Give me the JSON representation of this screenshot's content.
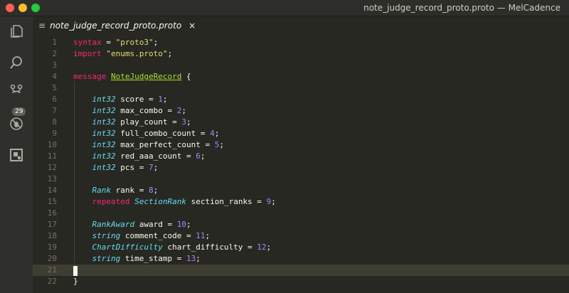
{
  "window": {
    "title": "note_judge_record_proto.proto — MelCadence"
  },
  "activity_bar": {
    "scm_badge": "29"
  },
  "tab": {
    "label": "note_judge_record_proto.proto",
    "close": "×"
  },
  "lines": [
    {
      "n": "1",
      "tokens": [
        {
          "t": "syntax",
          "c": "kw"
        },
        {
          "t": " = "
        },
        {
          "t": "\"proto3\"",
          "c": "str"
        },
        {
          "t": ";"
        }
      ]
    },
    {
      "n": "2",
      "tokens": [
        {
          "t": "import",
          "c": "kw"
        },
        {
          "t": " "
        },
        {
          "t": "\"enums.proto\"",
          "c": "str"
        },
        {
          "t": ";"
        }
      ]
    },
    {
      "n": "3",
      "tokens": []
    },
    {
      "n": "4",
      "tokens": [
        {
          "t": "message",
          "c": "kw"
        },
        {
          "t": " "
        },
        {
          "t": "NoteJudgeRecord",
          "c": "cls"
        },
        {
          "t": " {"
        }
      ]
    },
    {
      "n": "5",
      "tokens": []
    },
    {
      "n": "6",
      "tokens": [
        {
          "t": "    "
        },
        {
          "t": "int32",
          "c": "typ"
        },
        {
          "t": " score = "
        },
        {
          "t": "1",
          "c": "num"
        },
        {
          "t": ";"
        }
      ]
    },
    {
      "n": "7",
      "tokens": [
        {
          "t": "    "
        },
        {
          "t": "int32",
          "c": "typ"
        },
        {
          "t": " max_combo = "
        },
        {
          "t": "2",
          "c": "num"
        },
        {
          "t": ";"
        }
      ]
    },
    {
      "n": "8",
      "tokens": [
        {
          "t": "    "
        },
        {
          "t": "int32",
          "c": "typ"
        },
        {
          "t": " play_count = "
        },
        {
          "t": "3",
          "c": "num"
        },
        {
          "t": ";"
        }
      ]
    },
    {
      "n": "9",
      "tokens": [
        {
          "t": "    "
        },
        {
          "t": "int32",
          "c": "typ"
        },
        {
          "t": " full_combo_count = "
        },
        {
          "t": "4",
          "c": "num"
        },
        {
          "t": ";"
        }
      ]
    },
    {
      "n": "10",
      "tokens": [
        {
          "t": "    "
        },
        {
          "t": "int32",
          "c": "typ"
        },
        {
          "t": " max_perfect_count = "
        },
        {
          "t": "5",
          "c": "num"
        },
        {
          "t": ";"
        }
      ]
    },
    {
      "n": "11",
      "tokens": [
        {
          "t": "    "
        },
        {
          "t": "int32",
          "c": "typ"
        },
        {
          "t": " red_aaa_count = "
        },
        {
          "t": "6",
          "c": "num"
        },
        {
          "t": ";"
        }
      ]
    },
    {
      "n": "12",
      "tokens": [
        {
          "t": "    "
        },
        {
          "t": "int32",
          "c": "typ"
        },
        {
          "t": " pcs = "
        },
        {
          "t": "7",
          "c": "num"
        },
        {
          "t": ";"
        }
      ]
    },
    {
      "n": "13",
      "tokens": []
    },
    {
      "n": "14",
      "tokens": [
        {
          "t": "    "
        },
        {
          "t": "Rank",
          "c": "typ"
        },
        {
          "t": " rank = "
        },
        {
          "t": "8",
          "c": "num"
        },
        {
          "t": ";"
        }
      ]
    },
    {
      "n": "15",
      "tokens": [
        {
          "t": "    "
        },
        {
          "t": "repeated",
          "c": "kw"
        },
        {
          "t": " "
        },
        {
          "t": "SectionRank",
          "c": "typ"
        },
        {
          "t": " section_ranks = "
        },
        {
          "t": "9",
          "c": "num"
        },
        {
          "t": ";"
        }
      ]
    },
    {
      "n": "16",
      "tokens": []
    },
    {
      "n": "17",
      "tokens": [
        {
          "t": "    "
        },
        {
          "t": "RankAward",
          "c": "typ"
        },
        {
          "t": " award = "
        },
        {
          "t": "10",
          "c": "num"
        },
        {
          "t": ";"
        }
      ]
    },
    {
      "n": "18",
      "tokens": [
        {
          "t": "    "
        },
        {
          "t": "string",
          "c": "typ"
        },
        {
          "t": " comment_code = "
        },
        {
          "t": "11",
          "c": "num"
        },
        {
          "t": ";"
        }
      ]
    },
    {
      "n": "19",
      "tokens": [
        {
          "t": "    "
        },
        {
          "t": "ChartDifficulty",
          "c": "typ"
        },
        {
          "t": " chart_difficulty = "
        },
        {
          "t": "12",
          "c": "num"
        },
        {
          "t": ";"
        }
      ]
    },
    {
      "n": "20",
      "tokens": [
        {
          "t": "    "
        },
        {
          "t": "string",
          "c": "typ"
        },
        {
          "t": " time_stamp = "
        },
        {
          "t": "13",
          "c": "num"
        },
        {
          "t": ";"
        }
      ]
    },
    {
      "n": "21",
      "tokens": [],
      "current": true
    },
    {
      "n": "22",
      "tokens": [
        {
          "t": "}"
        }
      ]
    }
  ],
  "icons": {
    "explorer": "files-icon",
    "search": "search-icon",
    "scm": "source-control-icon",
    "debug": "debug-icon",
    "extensions": "extensions-icon"
  }
}
